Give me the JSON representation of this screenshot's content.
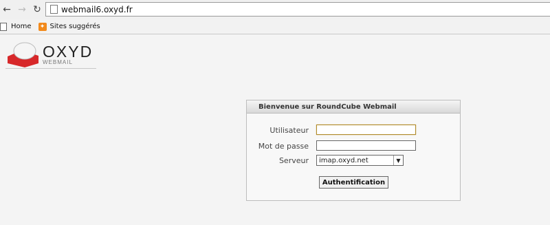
{
  "browser": {
    "url": "webmail6.oxyd.fr",
    "bookmarks": [
      {
        "label": "Home"
      },
      {
        "label": "Sites suggérés"
      }
    ]
  },
  "logo": {
    "main": "OXYD",
    "sub": "WEBMAIL",
    "colors": {
      "red": "#d7282a",
      "white": "#f5f5f5",
      "dark": "#222222"
    }
  },
  "login": {
    "title": "Bienvenue sur RoundCube Webmail",
    "username_label": "Utilisateur",
    "username_value": "",
    "password_label": "Mot de passe",
    "password_value": "",
    "server_label": "Serveur",
    "server_value": "imap.oxyd.net",
    "submit": "Authentification"
  }
}
